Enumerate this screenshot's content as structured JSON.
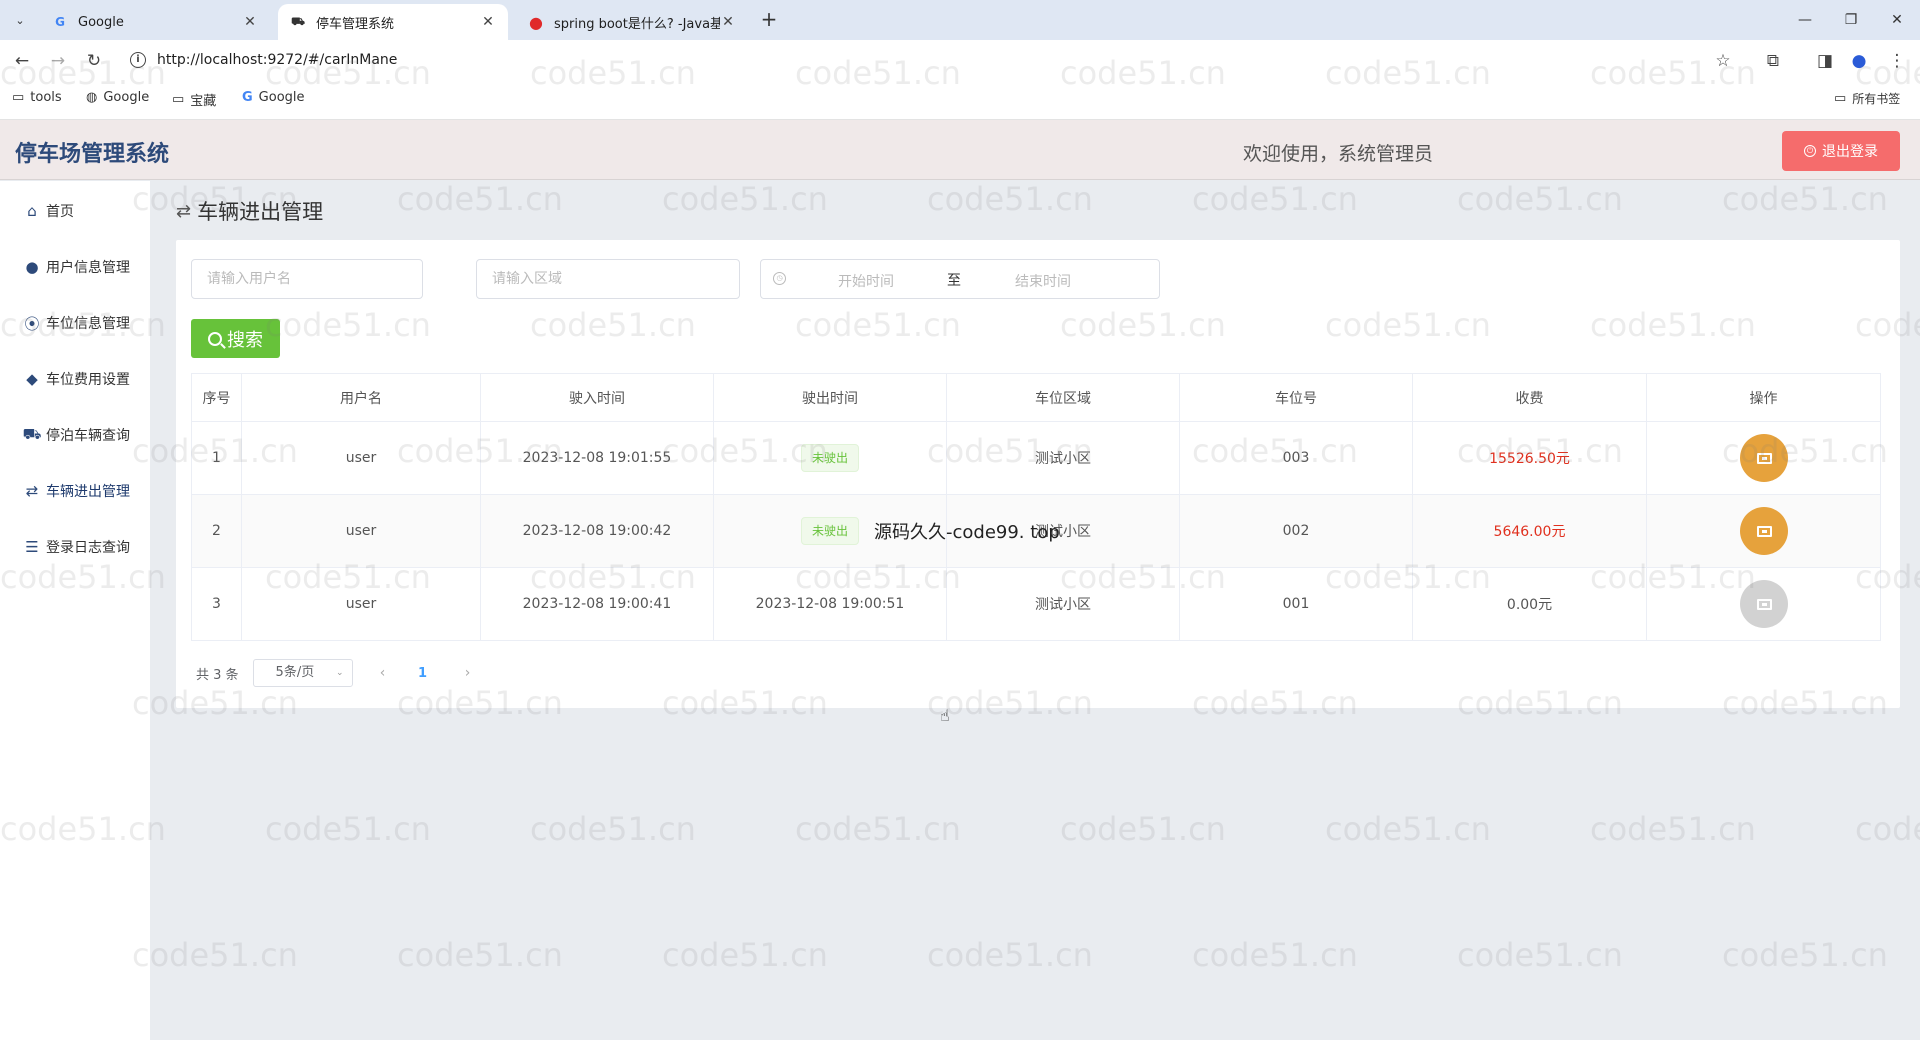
{
  "browser": {
    "tabs": [
      {
        "title": "Google",
        "favicon": "G"
      },
      {
        "title": "停车管理系统",
        "favicon": "⛟"
      },
      {
        "title": "spring boot是什么? -Java基础",
        "favicon": "●"
      }
    ],
    "new_tab": "+",
    "url": "http://localhost:9272/#/carInMane",
    "bookmarks": [
      {
        "label": "tools",
        "icon": "folder-icon"
      },
      {
        "label": "Google",
        "icon": "globe-icon"
      },
      {
        "label": "宝藏",
        "icon": "folder-icon"
      },
      {
        "label": "Google",
        "icon": "google-icon"
      }
    ],
    "all_bookmarks": "所有书签"
  },
  "header": {
    "app_title": "停车场管理系统",
    "welcome": "欢迎使用，系统管理员",
    "logout": "退出登录",
    "logout_color": "#f56c6c"
  },
  "sidebar": {
    "items": [
      {
        "label": "首页",
        "icon": "home-icon"
      },
      {
        "label": "用户信息管理",
        "icon": "user-icon"
      },
      {
        "label": "车位信息管理",
        "icon": "parking-location-icon"
      },
      {
        "label": "车位费用设置",
        "icon": "tag-icon"
      },
      {
        "label": "停泊车辆查询",
        "icon": "car-icon"
      },
      {
        "label": "车辆进出管理",
        "icon": "in-out-icon"
      },
      {
        "label": "登录日志查询",
        "icon": "log-icon"
      }
    ]
  },
  "page": {
    "title": "车辆进出管理",
    "filters": {
      "username_placeholder": "请输入用户名",
      "area_placeholder": "请输入区域",
      "start_placeholder": "开始时间",
      "range_separator": "至",
      "end_placeholder": "结束时间"
    },
    "search_label": "搜索",
    "search_color": "#67c23a"
  },
  "table": {
    "columns": [
      "序号",
      "用户名",
      "驶入时间",
      "驶出时间",
      "车位区域",
      "车位号",
      "收费",
      "操作"
    ],
    "rows": [
      {
        "index": "1",
        "user": "user",
        "in_time": "2023-12-08 19:01:55",
        "out_time": "未驶出",
        "area": "测试小区",
        "spot": "003",
        "fee": "15526.50元"
      },
      {
        "index": "2",
        "user": "user",
        "in_time": "2023-12-08 19:00:42",
        "out_time": "未驶出",
        "area": "测试小区",
        "spot": "002",
        "fee": "5646.00元"
      },
      {
        "index": "3",
        "user": "user",
        "in_time": "2023-12-08 19:00:41",
        "out_time": "2023-12-08 19:00:51",
        "area": "测试小区",
        "spot": "001",
        "fee": "0.00元"
      }
    ],
    "action_color": "#e6a23c"
  },
  "pagination": {
    "total": "共 3 条",
    "page_size": "5条/页",
    "current_page": "1"
  },
  "overlay": {
    "text": "源码久久-code99. top",
    "watermark": "code51.cn"
  }
}
